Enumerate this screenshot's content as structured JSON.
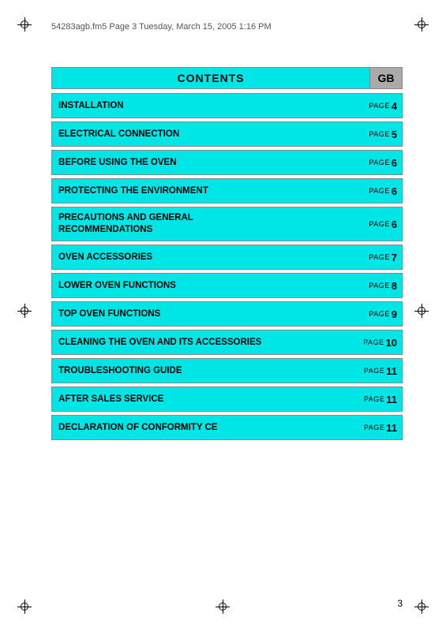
{
  "meta": {
    "header_text": "54283agb.fm5  Page 3  Tuesday, March 15, 2005  1:16 PM"
  },
  "title": {
    "label": "CONTENTS",
    "gb_label": "GB"
  },
  "toc": [
    {
      "label": "INSTALLATION",
      "page_word": "PAGE",
      "page_num": "4",
      "tall": false
    },
    {
      "label": "ELECTRICAL CONNECTION",
      "page_word": "PAGE",
      "page_num": "5",
      "tall": false
    },
    {
      "label": "BEFORE USING THE OVEN",
      "page_word": "PAGE",
      "page_num": "6",
      "tall": false
    },
    {
      "label": "PROTECTING THE ENVIRONMENT",
      "page_word": "PAGE",
      "page_num": "6",
      "tall": false
    },
    {
      "label": "PRECAUTIONS AND GENERAL\nRECOMMENDATIONS",
      "page_word": "PAGE",
      "page_num": "6",
      "tall": true
    },
    {
      "label": "OVEN ACCESSORIES",
      "page_word": "PAGE",
      "page_num": "7",
      "tall": false
    },
    {
      "label": "LOWER OVEN FUNCTIONS",
      "page_word": "PAGE",
      "page_num": "8",
      "tall": false
    },
    {
      "label": "TOP OVEN FUNCTIONS",
      "page_word": "PAGE",
      "page_num": "9",
      "tall": false
    },
    {
      "label": "CLEANING THE OVEN AND ITS ACCESSORIES",
      "page_word": "PAGE",
      "page_num": "10",
      "tall": false
    },
    {
      "label": "TROUBLESHOOTING GUIDE",
      "page_word": "PAGE",
      "page_num": "11",
      "tall": false
    },
    {
      "label": "AFTER SALES SERVICE",
      "page_word": "PAGE",
      "page_num": "11",
      "tall": false
    },
    {
      "label": "DECLARATION OF CONFORMITY CE",
      "page_word": "PAGE",
      "page_num": "11",
      "tall": false
    }
  ],
  "page_number": "3"
}
